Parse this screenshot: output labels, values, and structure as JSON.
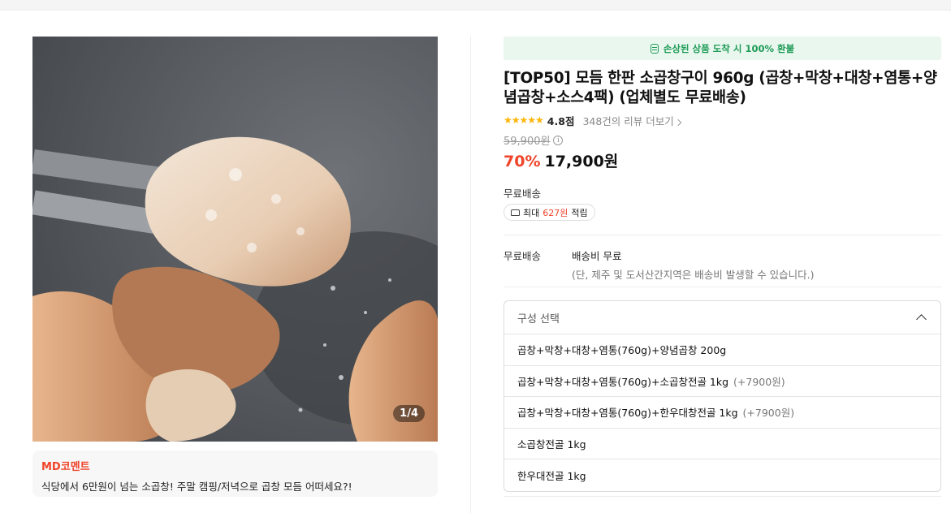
{
  "banner": {
    "text": "손상된 상품 도착 시 100% 환불",
    "icon": "receipt-icon",
    "color": "#1e9b56"
  },
  "product": {
    "title": "[TOP50] 모듬 한판 소곱창구이 960g (곱창+막창+대창+염통+양념곱창+소스4팩) (업체별도 무료배송)",
    "rating_stars": "★★★★★",
    "rating_score": "4.8점",
    "review_link": "348건의 리뷰 더보기",
    "original_price": "59,900원",
    "discount": "70%",
    "price": "17,900원",
    "image_counter": "1/4"
  },
  "delivery": {
    "label": "무료배송",
    "points_prefix": "최대",
    "points_value": "627원",
    "points_suffix": "적립"
  },
  "shipping": {
    "key": "무료배송",
    "value": "배송비 무료",
    "note": "(단, 제주 및 도서산간지역은 배송비 발생할 수 있습니다.)"
  },
  "options": {
    "header": "구성 선택",
    "items": [
      {
        "label": "곱창+막창+대창+염통(760g)+양념곱창 200g",
        "extra": ""
      },
      {
        "label": "곱창+막창+대창+염통(760g)+소곱창전골 1kg",
        "extra": "(+7900원)"
      },
      {
        "label": "곱창+막창+대창+염통(760g)+한우대창전골 1kg",
        "extra": "(+7900원)"
      },
      {
        "label": "소곱창전골 1kg",
        "extra": ""
      },
      {
        "label": "한우대전골 1kg",
        "extra": ""
      }
    ]
  },
  "md": {
    "title": "MD코멘트",
    "text": "식당에서 6만원이 넘는 소곱창! 주말 캠핑/저녁으로 곱창 모듬 어떠세요?!"
  },
  "colors": {
    "accent": "#f0442a",
    "star": "#ffb400"
  }
}
